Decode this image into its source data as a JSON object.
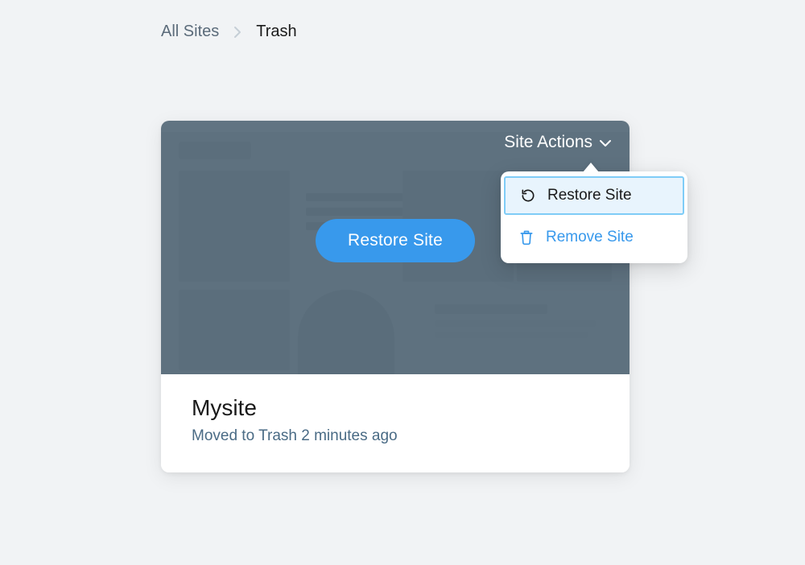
{
  "breadcrumb": {
    "parent": "All Sites",
    "current": "Trash"
  },
  "card": {
    "actions_label": "Site Actions",
    "restore_button": "Restore Site",
    "site_name": "Mysite",
    "status": "Moved to Trash 2 minutes ago"
  },
  "dropdown": {
    "restore": "Restore Site",
    "remove": "Remove Site"
  }
}
